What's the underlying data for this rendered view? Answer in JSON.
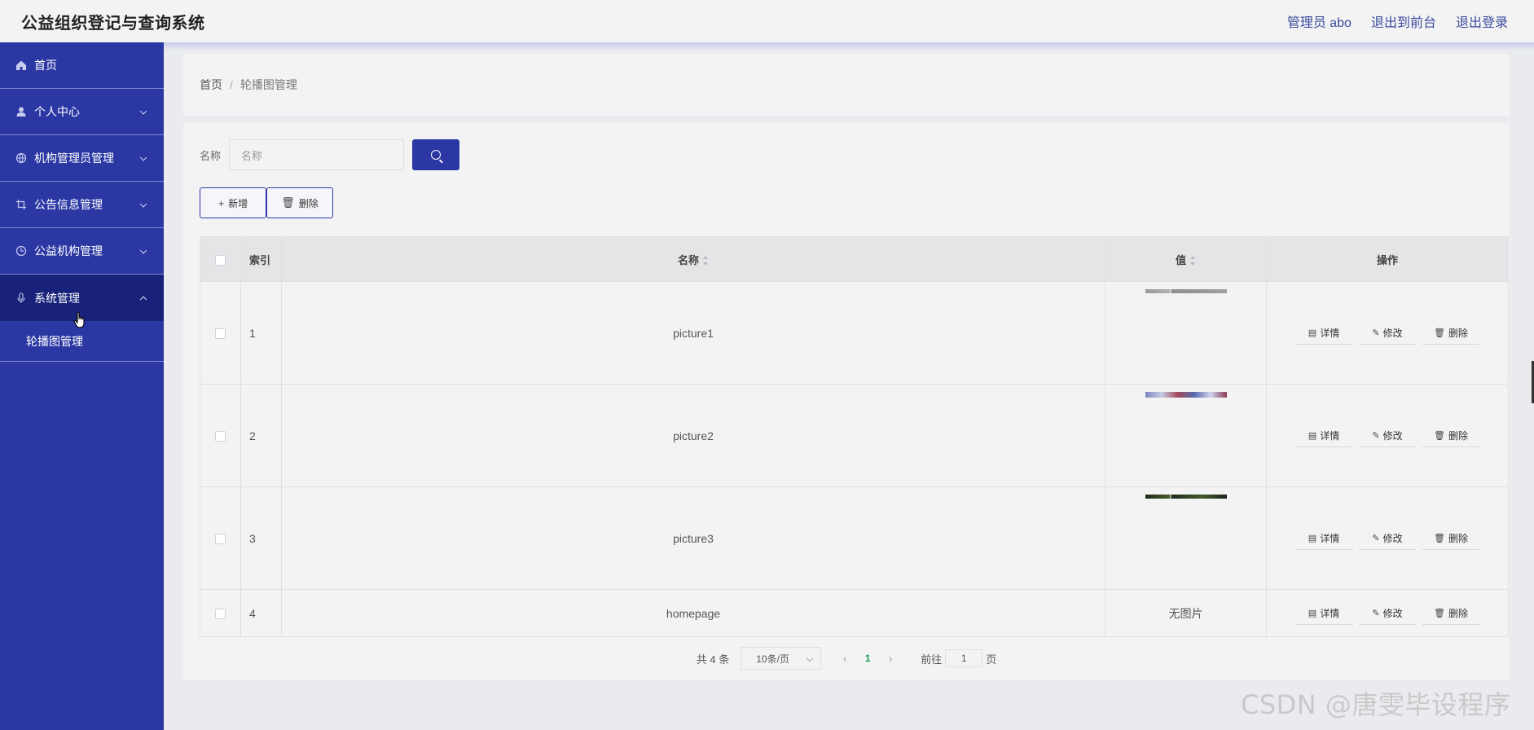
{
  "app": {
    "title": "公益组织登记与查询系统"
  },
  "header": {
    "admin_label": "管理员 abo",
    "to_front": "退出到前台",
    "logout": "退出登录"
  },
  "sidebar": {
    "items": [
      {
        "label": "首页",
        "icon": "home-icon"
      },
      {
        "label": "个人中心",
        "icon": "user-icon"
      },
      {
        "label": "机构管理员管理",
        "icon": "globe-icon"
      },
      {
        "label": "公告信息管理",
        "icon": "crop-icon"
      },
      {
        "label": "公益机构管理",
        "icon": "clock-icon"
      },
      {
        "label": "系统管理",
        "icon": "mic-icon"
      }
    ],
    "submenu": {
      "label": "轮播图管理"
    }
  },
  "breadcrumb": {
    "home": "首页",
    "sep": "/",
    "current": "轮播图管理"
  },
  "search": {
    "label": "名称",
    "placeholder": "名称"
  },
  "actions": {
    "add": "新增",
    "delete": "删除"
  },
  "table": {
    "headers": {
      "index": "索引",
      "name": "名称",
      "value": "值",
      "ops": "操作"
    },
    "rows": [
      {
        "index": "1",
        "name": "picture1",
        "value": ""
      },
      {
        "index": "2",
        "name": "picture2",
        "value": ""
      },
      {
        "index": "3",
        "name": "picture3",
        "value": ""
      },
      {
        "index": "4",
        "name": "homepage",
        "value": "无图片"
      }
    ],
    "row_actions": {
      "detail": "详情",
      "edit": "修改",
      "delete": "删除"
    }
  },
  "pager": {
    "total": "共 4 条",
    "page_size": "10条/页",
    "current_page": "1",
    "goto_label": "前往",
    "goto_value": "1",
    "page_unit": "页"
  },
  "watermark": "CSDN @唐雯毕设程序",
  "colors": {
    "sidebar": "#2b38a3",
    "sidebar_active": "#18227a",
    "accent": "#2b38a3"
  }
}
